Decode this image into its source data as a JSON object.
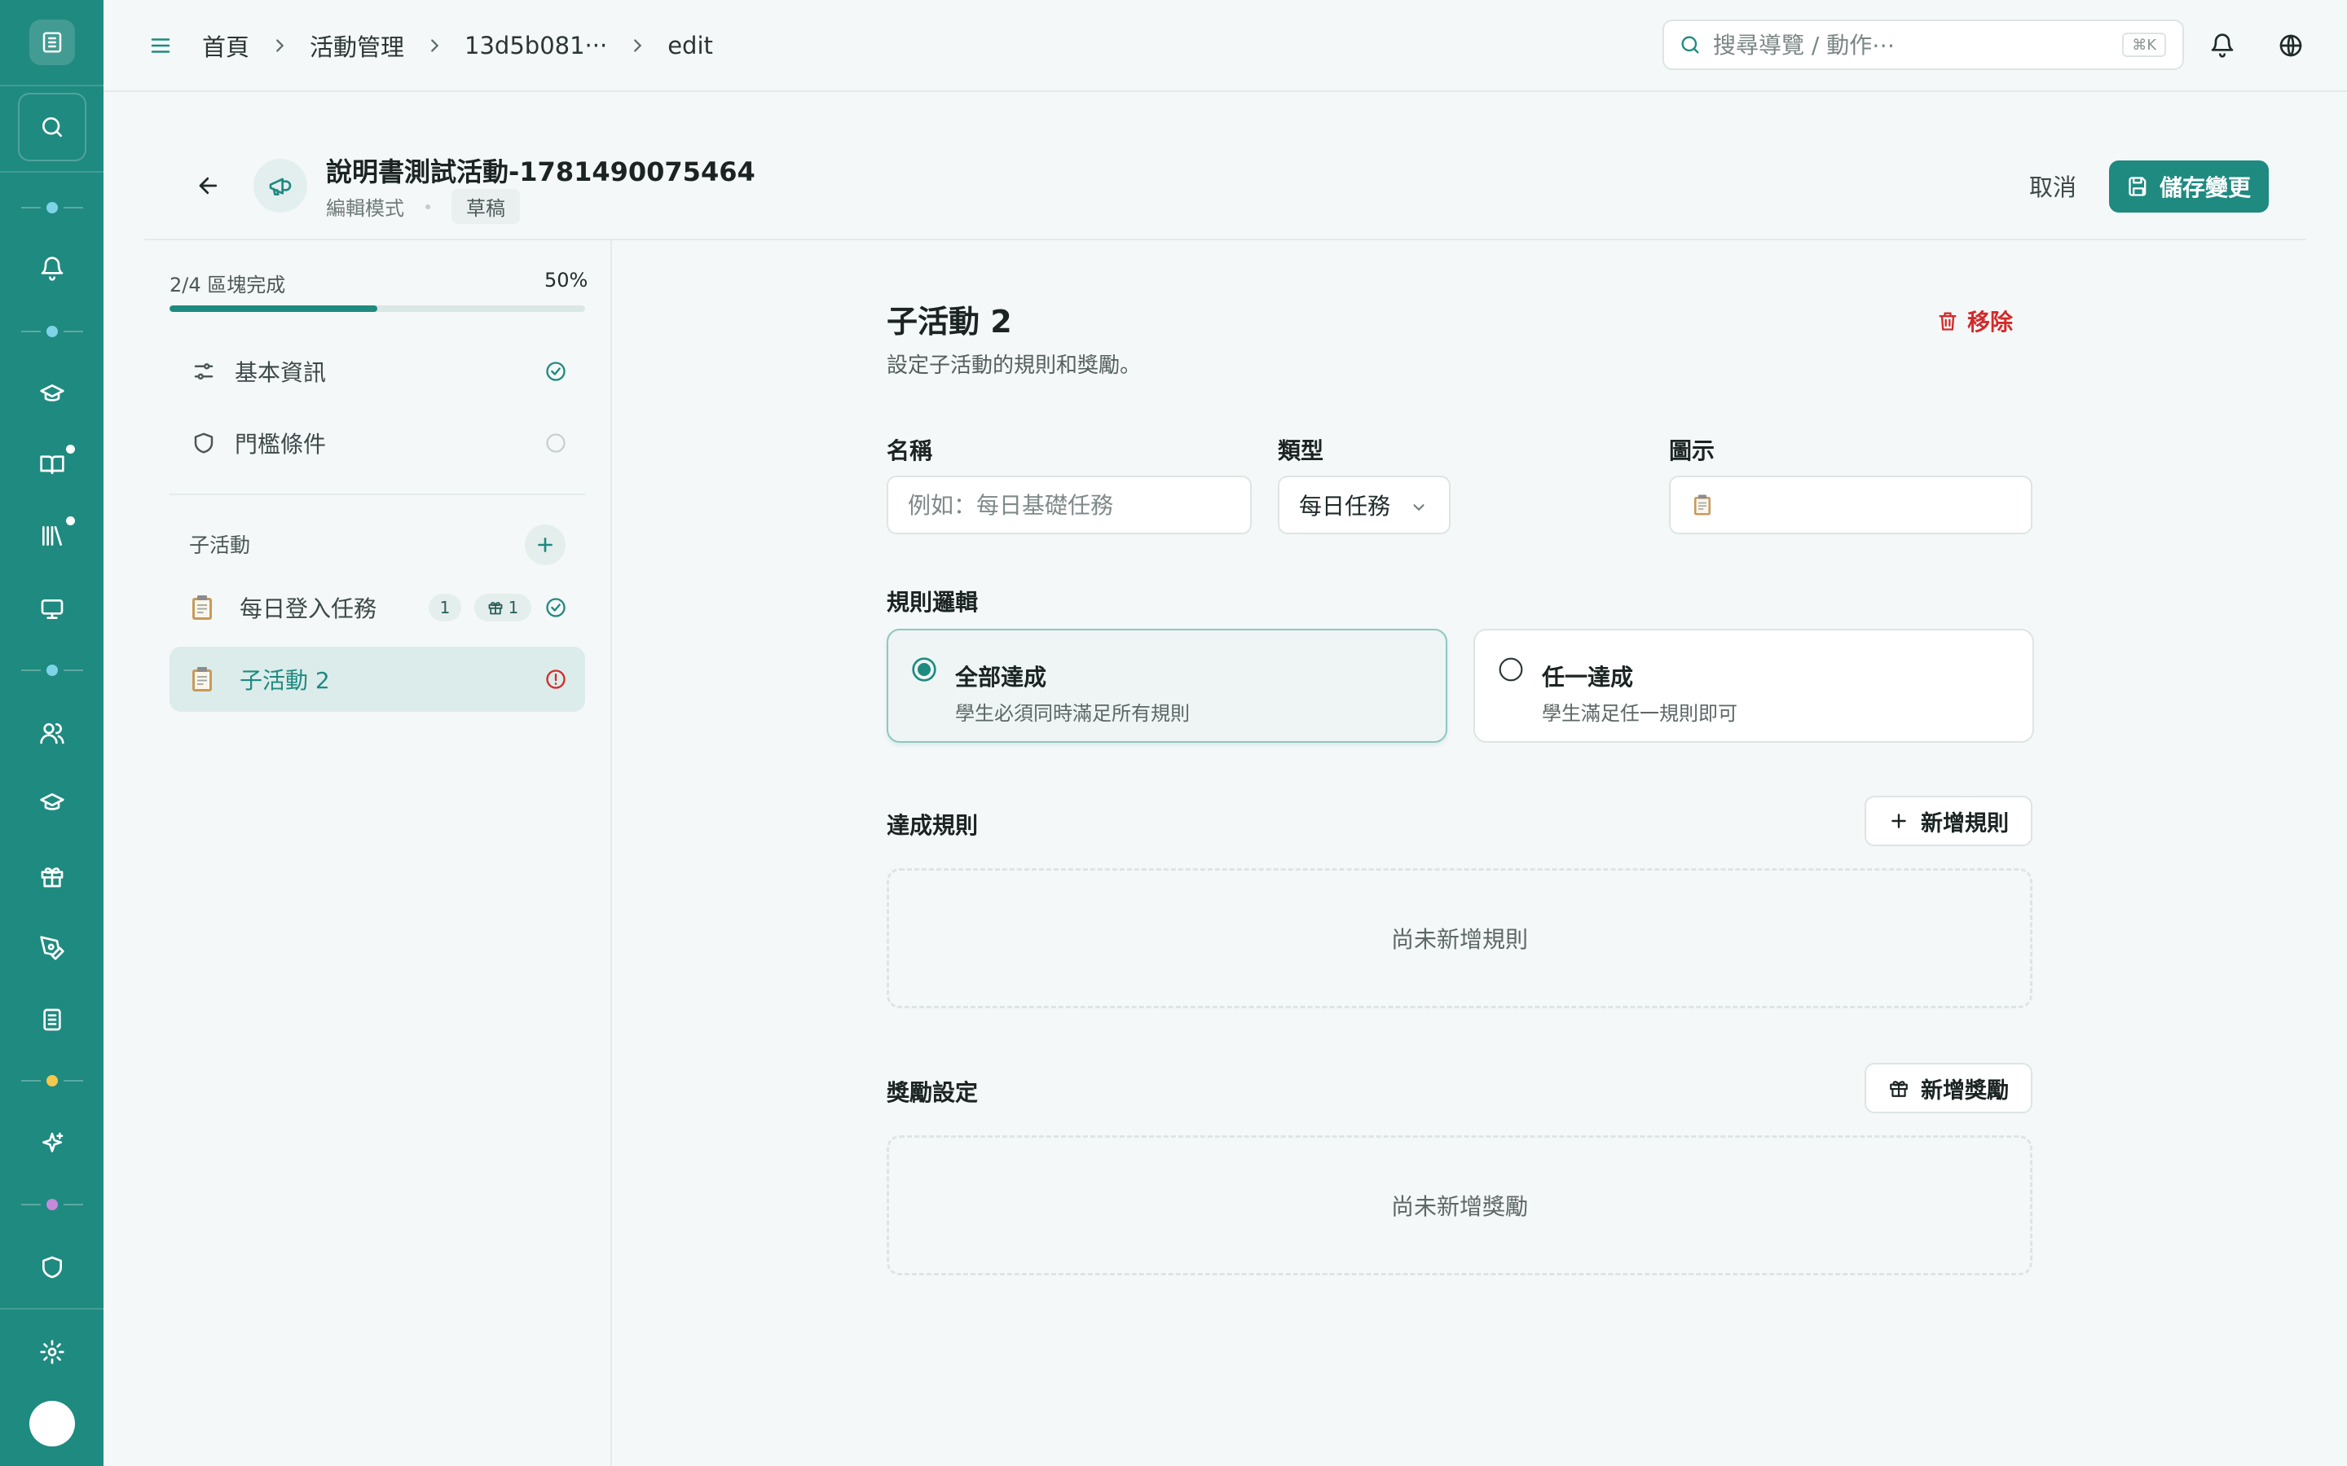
{
  "topbar": {
    "breadcrumbs": [
      "首頁",
      "活動管理",
      "13d5b081···",
      "edit"
    ],
    "search_placeholder": "搜尋導覽 / 動作⋯",
    "search_shortcut": "⌘K"
  },
  "header": {
    "title": "說明書測試活動-1781490075464",
    "mode": "編輯模式",
    "status": "草稿",
    "cancel_label": "取消",
    "save_label": "儲存變更"
  },
  "progress": {
    "label": "2/4 區塊完成",
    "percent_text": "50%",
    "value": 0.5
  },
  "sections": [
    {
      "label": "基本資訊",
      "icon": "sliders-icon",
      "status": "complete"
    },
    {
      "label": "門檻條件",
      "icon": "shield-icon",
      "status": "pending"
    }
  ],
  "sub_activities": {
    "heading": "子活動",
    "items": [
      {
        "label": "每日登入任務",
        "rule_count": "1",
        "reward_count": "1",
        "status": "complete"
      },
      {
        "label": "子活動 2",
        "status": "error",
        "active": true
      }
    ]
  },
  "form": {
    "title": "子活動 2",
    "description": "設定子活動的規則和獎勵。",
    "remove_label": "移除",
    "name_label": "名稱",
    "name_placeholder": "例如：每日基礎任務",
    "name_value": "",
    "type_label": "類型",
    "type_value": "每日任務",
    "icon_label": "圖示",
    "icon_value": "clipboard-icon",
    "rule_logic_label": "規則邏輯",
    "logic_options": [
      {
        "title": "全部達成",
        "desc": "學生必須同時滿足所有規則",
        "selected": true
      },
      {
        "title": "任一達成",
        "desc": "學生滿足任一規則即可",
        "selected": false
      }
    ],
    "rules_label": "達成規則",
    "add_rule_label": "新增規則",
    "rules_empty": "尚未新增規則",
    "rewards_label": "獎勵設定",
    "add_reward_label": "新增獎勵",
    "rewards_empty": "尚未新增獎勵"
  },
  "colors": {
    "brand": "#1f8a80",
    "danger": "#d42a2a",
    "rail_dot_1": "#7fd3e6",
    "rail_dot_2": "#7fd3e6",
    "rail_dot_3": "#7fd3e6",
    "rail_dot_4": "#f2c94c",
    "rail_dot_5": "#c58ad9"
  }
}
